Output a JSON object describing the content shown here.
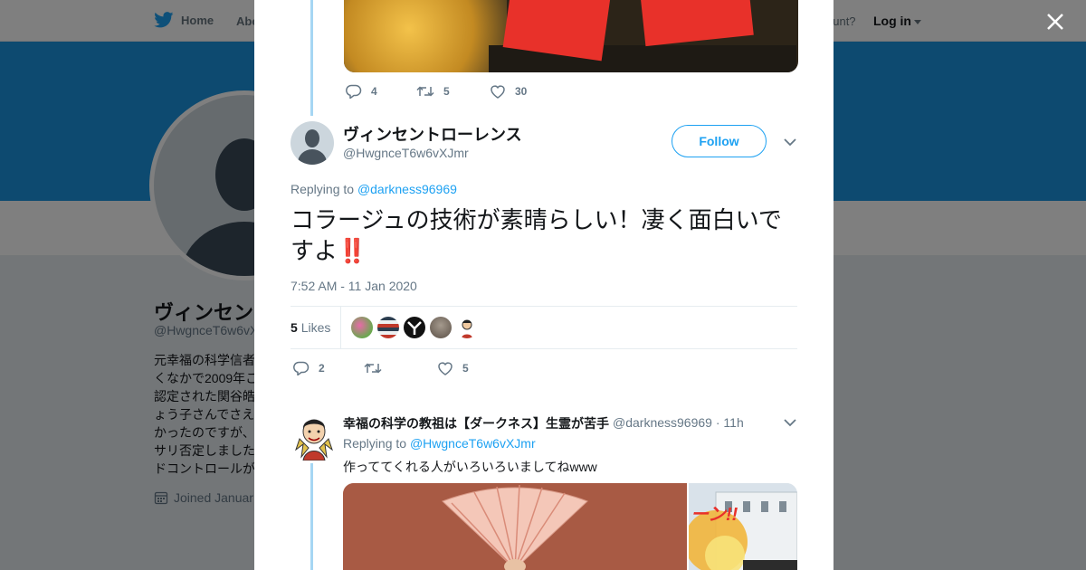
{
  "nav": {
    "home": "Home",
    "about": "Abo",
    "account_prompt": "ccount?",
    "login": "Log in"
  },
  "profile": {
    "name": "ヴィンセン",
    "handle": "@HwgnceT6w6vX",
    "bio_lines": [
      "元幸福の科学信者",
      "くなかで2009年こ",
      "認定された関谷皓",
      "ょう子さんでさえ",
      "かったのですが、",
      "サリ否定しました",
      "ドコントロールが"
    ],
    "joined": "Joined Januar"
  },
  "previous_tweet": {
    "reply_count": "4",
    "retweet_count": "5",
    "like_count": "30"
  },
  "tweet": {
    "author_name": "ヴィンセントローレンス",
    "author_handle": "@HwgnceT6w6vXJmr",
    "follow_label": "Follow",
    "replying_prefix": "Replying to",
    "replying_to": "@darkness96969",
    "text": "コラージュの技術が素晴らしい！凄く面白いですよ",
    "emoji": "‼️",
    "timestamp": "7:52 AM - 11 Jan 2020",
    "likes_count": "5",
    "likes_label": "Likes",
    "reply_count": "2",
    "like_count": "5"
  },
  "reply": {
    "author_name": "幸福の科学の教祖は【ダークネス】生霊が苦手",
    "author_handle": "@darkness96969",
    "time": "11h",
    "replying_prefix": "Replying to",
    "replying_to": "@HwgnceT6w6vXJmr",
    "text": "作っててくれる人がいろいろいましてねwww",
    "image_caption": "ーン!!"
  },
  "colors": {
    "accent": "#1da1f2",
    "banner": "#1b95e0",
    "thread_line": "#a6d6f3",
    "emoji_red": "#be1931"
  },
  "icons": [
    "twitter-bird-icon",
    "close-icon",
    "reply-icon",
    "retweet-icon",
    "heart-icon",
    "chevron-down-icon",
    "calendar-icon"
  ]
}
